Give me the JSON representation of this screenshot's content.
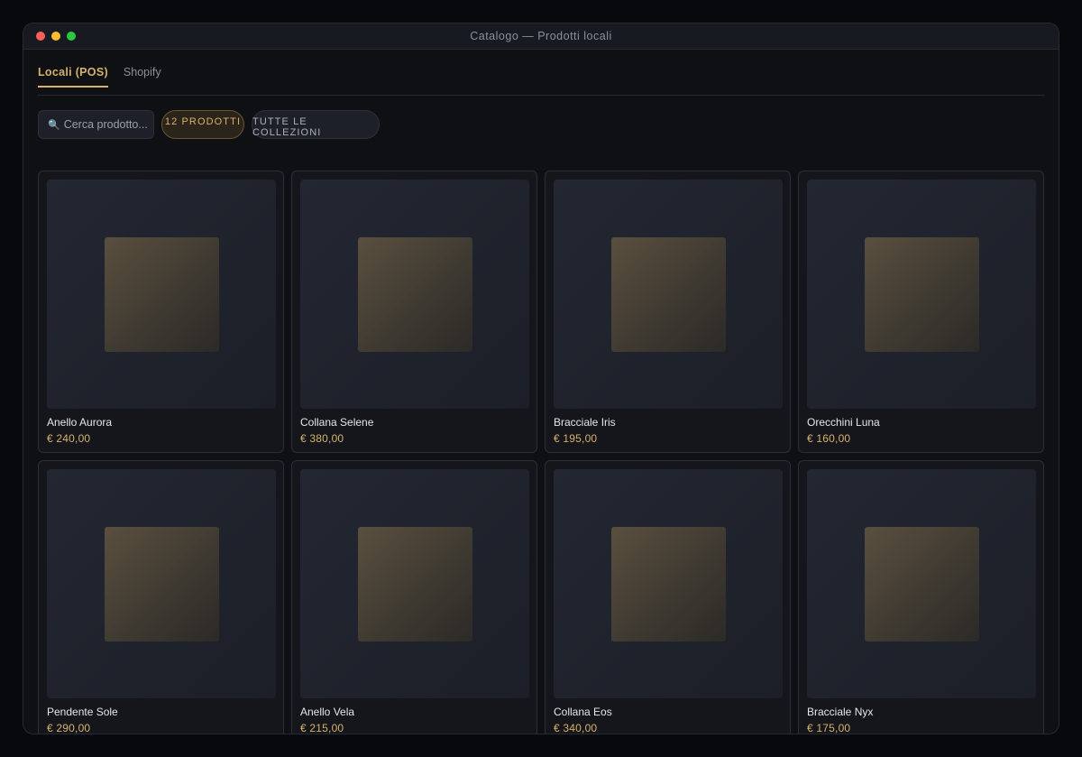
{
  "window": {
    "title": "Catalogo — Prodotti locali"
  },
  "tabs": [
    {
      "label": "Locali (POS)",
      "active": true
    },
    {
      "label": "Shopify",
      "active": false
    }
  ],
  "toolbar": {
    "search_placeholder": "Cerca prodotto...",
    "count_label": "12 prodotti",
    "collections_label": "Tutte le collezioni"
  },
  "products": [
    {
      "name": "Anello Aurora",
      "price": "€ 240,00"
    },
    {
      "name": "Collana Selene",
      "price": "€ 380,00"
    },
    {
      "name": "Bracciale Iris",
      "price": "€ 195,00"
    },
    {
      "name": "Orecchini Luna",
      "price": "€ 160,00"
    },
    {
      "name": "Pendente Sole",
      "price": "€ 290,00"
    },
    {
      "name": "Anello Vela",
      "price": "€ 215,00"
    },
    {
      "name": "Collana Eos",
      "price": "€ 340,00"
    },
    {
      "name": "Bracciale Nyx",
      "price": "€ 175,00"
    }
  ],
  "colors": {
    "accent": "#d8b26a",
    "background": "#0e1014"
  }
}
